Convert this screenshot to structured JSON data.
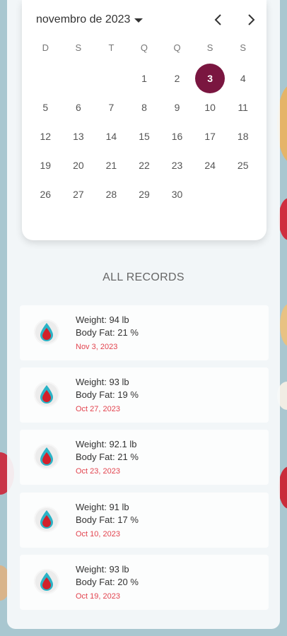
{
  "calendar": {
    "month_label": "novembro de 2023",
    "weekdays": [
      "D",
      "S",
      "T",
      "Q",
      "Q",
      "S",
      "S"
    ],
    "days": [
      "",
      "",
      "",
      "1",
      "2",
      "3",
      "4",
      "5",
      "6",
      "7",
      "8",
      "9",
      "10",
      "11",
      "12",
      "13",
      "14",
      "15",
      "16",
      "17",
      "18",
      "19",
      "20",
      "21",
      "22",
      "23",
      "24",
      "25",
      "26",
      "27",
      "28",
      "29",
      "30"
    ],
    "selected_day": "3"
  },
  "records_section": {
    "title": "ALL RECORDS"
  },
  "records": [
    {
      "weight": "Weight: 94 lb",
      "body_fat": "Body Fat: 21 %",
      "date": "Nov 3, 2023"
    },
    {
      "weight": "Weight: 93 lb",
      "body_fat": "Body Fat: 19 %",
      "date": "Oct 27, 2023"
    },
    {
      "weight": "Weight: 92.1 lb",
      "body_fat": "Body Fat: 21 %",
      "date": "Oct 23, 2023"
    },
    {
      "weight": "Weight: 91 lb",
      "body_fat": "Body Fat: 17 %",
      "date": "Oct 10, 2023"
    },
    {
      "weight": "Weight: 93 lb",
      "body_fat": "Body Fat: 20 %",
      "date": "Oct 19, 2023"
    }
  ],
  "colors": {
    "accent": "#7a1640",
    "date_text": "#e2434e",
    "drop_red": "#d2212b",
    "drop_teal": "#2bb3c6"
  },
  "icons": {
    "prev": "chevron-left-icon",
    "next": "chevron-right-icon",
    "caret": "caret-down-icon",
    "record": "blood-drop-icon"
  }
}
